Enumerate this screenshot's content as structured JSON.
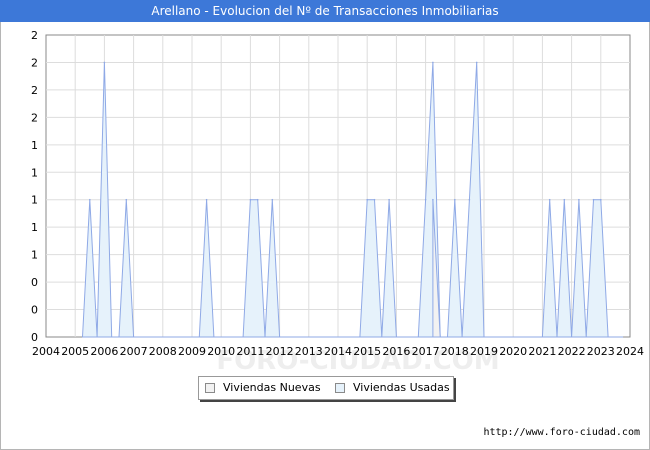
{
  "chart_data": {
    "type": "area",
    "title": "Arellano - Evolucion del Nº de Transacciones Inmobiliarias",
    "xlabel": "",
    "ylabel": "",
    "x_ticks": [
      "2004",
      "2005",
      "2006",
      "2007",
      "2008",
      "2009",
      "2010",
      "2011",
      "2012",
      "2013",
      "2014",
      "2015",
      "2016",
      "2017",
      "2018",
      "2019",
      "2020",
      "2021",
      "2022",
      "2023",
      "2024"
    ],
    "y_tick_labels": [
      "0",
      "0",
      "0",
      "1",
      "1",
      "1",
      "1",
      "1",
      "2",
      "2",
      "2",
      "2"
    ],
    "ylim": [
      0,
      2.2
    ],
    "xlim": [
      2004,
      2024
    ],
    "grid": true,
    "legend_position": "bottom",
    "colors": {
      "nuevas_fill": "#f2f2f2",
      "usadas_fill": "#e6f2fb",
      "line": "#8fa9e6",
      "grid": "#dddddd",
      "watermark": "#eeeeee"
    },
    "series": [
      {
        "name": "Viviendas Nuevas",
        "x": [
          2017.25,
          2017.5
        ],
        "y": [
          1,
          0
        ]
      },
      {
        "name": "Viviendas Usadas",
        "x": [
          2005.25,
          2005.5,
          2005.75,
          2006.0,
          2006.25,
          2006.5,
          2006.75,
          2007.0,
          2007.25,
          2009.25,
          2009.5,
          2009.75,
          2010.75,
          2011.0,
          2011.25,
          2011.5,
          2011.75,
          2012.0,
          2012.25,
          2014.75,
          2015.0,
          2015.25,
          2015.5,
          2015.75,
          2016.0,
          2016.75,
          2017.0,
          2017.25,
          2017.5,
          2017.75,
          2018.0,
          2018.25,
          2018.5,
          2018.75,
          2019.0,
          2019.25,
          2019.5,
          2021.0,
          2021.25,
          2021.5,
          2021.75,
          2022.0,
          2022.25,
          2022.5,
          2022.75,
          2023.0,
          2023.25,
          2023.5,
          2023.75
        ],
        "y": [
          0,
          1,
          0,
          2,
          0,
          0,
          1,
          0,
          0,
          0,
          1,
          0,
          0,
          1,
          1,
          0,
          1,
          0,
          0,
          0,
          1,
          1,
          0,
          1,
          0,
          0,
          1,
          2,
          0,
          0,
          1,
          0,
          1,
          2,
          0,
          0,
          0,
          0,
          1,
          0,
          1,
          0,
          1,
          0,
          1,
          1,
          0,
          0,
          0
        ]
      }
    ]
  },
  "legend": {
    "items": [
      "Viviendas Nuevas",
      "Viviendas Usadas"
    ]
  },
  "source_url": "http://www.foro-ciudad.com",
  "watermark": "FORO-CIUDAD.COM"
}
